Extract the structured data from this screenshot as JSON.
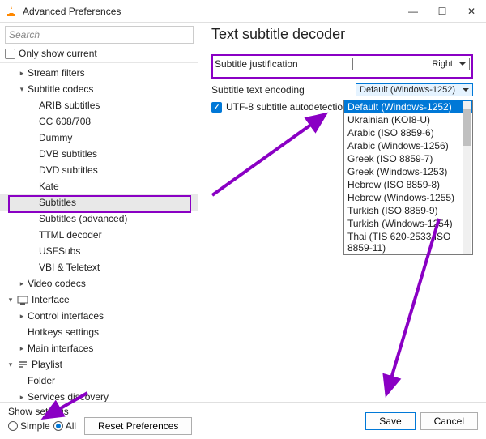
{
  "window": {
    "title": "Advanced Preferences",
    "minimize": "—",
    "maximize": "☐",
    "close": "✕"
  },
  "search": {
    "placeholder": "Search"
  },
  "only_current": {
    "label": "Only show current"
  },
  "tree": [
    {
      "level": 1,
      "arrow": ">",
      "label": "Stream filters",
      "interact": true
    },
    {
      "level": 1,
      "arrow": "v",
      "label": "Subtitle codecs",
      "interact": true
    },
    {
      "level": 2,
      "arrow": "",
      "label": "ARIB subtitles",
      "interact": true
    },
    {
      "level": 2,
      "arrow": "",
      "label": "CC 608/708",
      "interact": true
    },
    {
      "level": 2,
      "arrow": "",
      "label": "Dummy",
      "interact": true
    },
    {
      "level": 2,
      "arrow": "",
      "label": "DVB subtitles",
      "interact": true
    },
    {
      "level": 2,
      "arrow": "",
      "label": "DVD subtitles",
      "interact": true
    },
    {
      "level": 2,
      "arrow": "",
      "label": "Kate",
      "interact": true
    },
    {
      "level": 2,
      "arrow": "",
      "label": "Subtitles",
      "interact": true,
      "selected": true
    },
    {
      "level": 2,
      "arrow": "",
      "label": "Subtitles (advanced)",
      "interact": true
    },
    {
      "level": 2,
      "arrow": "",
      "label": "TTML decoder",
      "interact": true
    },
    {
      "level": 2,
      "arrow": "",
      "label": "USFSubs",
      "interact": true
    },
    {
      "level": 2,
      "arrow": "",
      "label": "VBI & Teletext",
      "interact": true
    },
    {
      "level": 1,
      "arrow": ">",
      "label": "Video codecs",
      "interact": true
    },
    {
      "level": 0,
      "arrow": "v",
      "icon": "interface",
      "label": "Interface",
      "interact": true
    },
    {
      "level": 1,
      "arrow": ">",
      "label": "Control interfaces",
      "interact": true
    },
    {
      "level": 1,
      "arrow": "",
      "label": "Hotkeys settings",
      "interact": true
    },
    {
      "level": 1,
      "arrow": ">",
      "label": "Main interfaces",
      "interact": true
    },
    {
      "level": 0,
      "arrow": "v",
      "icon": "playlist",
      "label": "Playlist",
      "interact": true
    },
    {
      "level": 1,
      "arrow": "",
      "label": "Folder",
      "interact": true
    },
    {
      "level": 1,
      "arrow": ">",
      "label": "Services discovery",
      "interact": true
    }
  ],
  "panel": {
    "title": "Text subtitle decoder",
    "justification": {
      "label": "Subtitle justification",
      "value": "Right"
    },
    "encoding": {
      "label": "Subtitle text encoding",
      "value": "Default (Windows-1252)"
    },
    "autodetect": {
      "label": "UTF-8 subtitle autodetection",
      "checked": true
    },
    "encoding_options": [
      "Default (Windows-1252)",
      "Ukrainian (KOI8-U)",
      "Arabic (ISO 8859-6)",
      "Arabic (Windows-1256)",
      "Greek (ISO 8859-7)",
      "Greek (Windows-1253)",
      "Hebrew (ISO 8859-8)",
      "Hebrew (Windows-1255)",
      "Turkish (ISO 8859-9)",
      "Turkish (Windows-1254)",
      "Thai (TIS 620-2533/ISO 8859-11)"
    ]
  },
  "bottom": {
    "show_settings": "Show settings",
    "simple": "Simple",
    "all": "All",
    "reset": "Reset Preferences",
    "save": "Save",
    "cancel": "Cancel"
  }
}
